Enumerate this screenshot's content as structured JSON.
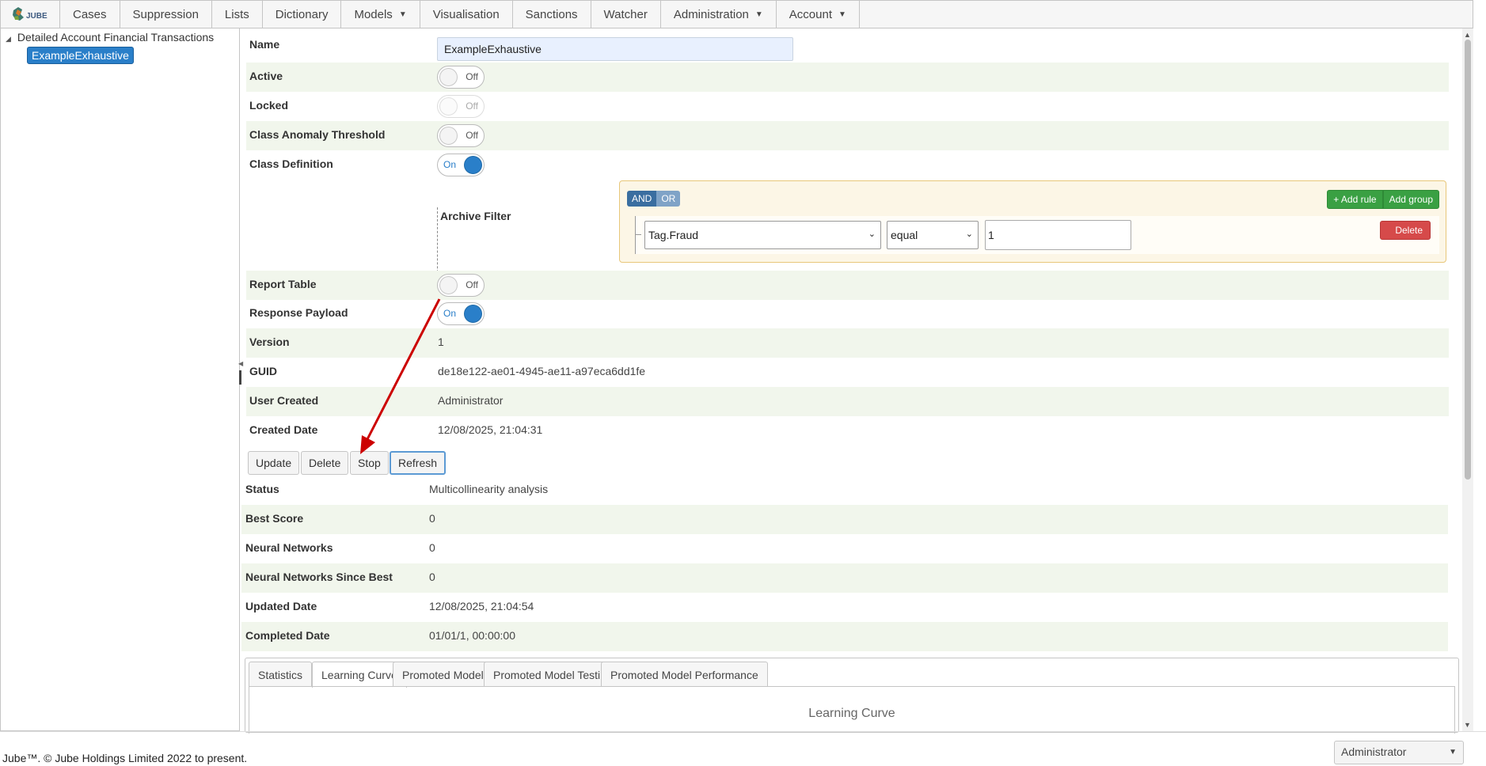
{
  "menu": {
    "logo_text": "JUBE",
    "items": [
      {
        "label": "Cases",
        "dropdown": false
      },
      {
        "label": "Suppression",
        "dropdown": false
      },
      {
        "label": "Lists",
        "dropdown": false
      },
      {
        "label": "Dictionary",
        "dropdown": false
      },
      {
        "label": "Models",
        "dropdown": true
      },
      {
        "label": "Visualisation",
        "dropdown": false
      },
      {
        "label": "Sanctions",
        "dropdown": false
      },
      {
        "label": "Watcher",
        "dropdown": false
      },
      {
        "label": "Administration",
        "dropdown": true
      },
      {
        "label": "Account",
        "dropdown": true
      }
    ]
  },
  "tree": {
    "root_label": "Detailed Account Financial Transactions",
    "selected_item": "ExampleExhaustive"
  },
  "form": {
    "name_label": "Name",
    "name_value": "ExampleExhaustive",
    "active_label": "Active",
    "active_state": "Off",
    "locked_label": "Locked",
    "locked_state": "Off",
    "class_anomaly_label": "Class Anomaly Threshold",
    "class_anomaly_state": "Off",
    "class_definition_label": "Class Definition",
    "class_definition_state": "On",
    "archive_filter_label": "Archive Filter",
    "report_table_label": "Report Table",
    "report_table_state": "Off",
    "response_payload_label": "Response Payload",
    "response_payload_state": "On",
    "version_label": "Version",
    "version_value": "1",
    "guid_label": "GUID",
    "guid_value": "de18e122-ae01-4945-ae11-a97eca6dd1fe",
    "user_created_label": "User Created",
    "user_created_value": "Administrator",
    "created_date_label": "Created Date",
    "created_date_value": "12/08/2025, 21:04:31"
  },
  "query_builder": {
    "and_label": "AND",
    "or_label": "OR",
    "add_rule_label": "+ Add rule",
    "add_group_label": "Add group",
    "rule": {
      "field": "Tag.Fraud",
      "operator": "equal",
      "value": "1",
      "delete_label": "Delete"
    }
  },
  "actions": {
    "update": "Update",
    "delete": "Delete",
    "stop": "Stop",
    "refresh": "Refresh"
  },
  "status": {
    "status_label": "Status",
    "status_value": "Multicollinearity analysis",
    "best_score_label": "Best Score",
    "best_score_value": "0",
    "neural_networks_label": "Neural Networks",
    "neural_networks_value": "0",
    "nn_since_best_label": "Neural Networks Since Best",
    "nn_since_best_value": "0",
    "updated_date_label": "Updated Date",
    "updated_date_value": "12/08/2025, 21:04:54",
    "completed_date_label": "Completed Date",
    "completed_date_value": "01/01/1, 00:00:00"
  },
  "tabs": {
    "items": [
      "Statistics",
      "Learning Curve",
      "Promoted Models",
      "Promoted Model Testing",
      "Promoted Model Performance"
    ],
    "active": "Learning Curve",
    "panel_title": "Learning Curve"
  },
  "footer": {
    "copyright": "Jube™. © Jube Holdings Limited 2022 to present.",
    "user": "Administrator"
  },
  "colors": {
    "accent": "#2a7fc9",
    "row_alt": "#f1f6ec",
    "annotation_arrow": "#cc0000",
    "add_rule_green": "#3aa043",
    "delete_red": "#d64a4a"
  }
}
